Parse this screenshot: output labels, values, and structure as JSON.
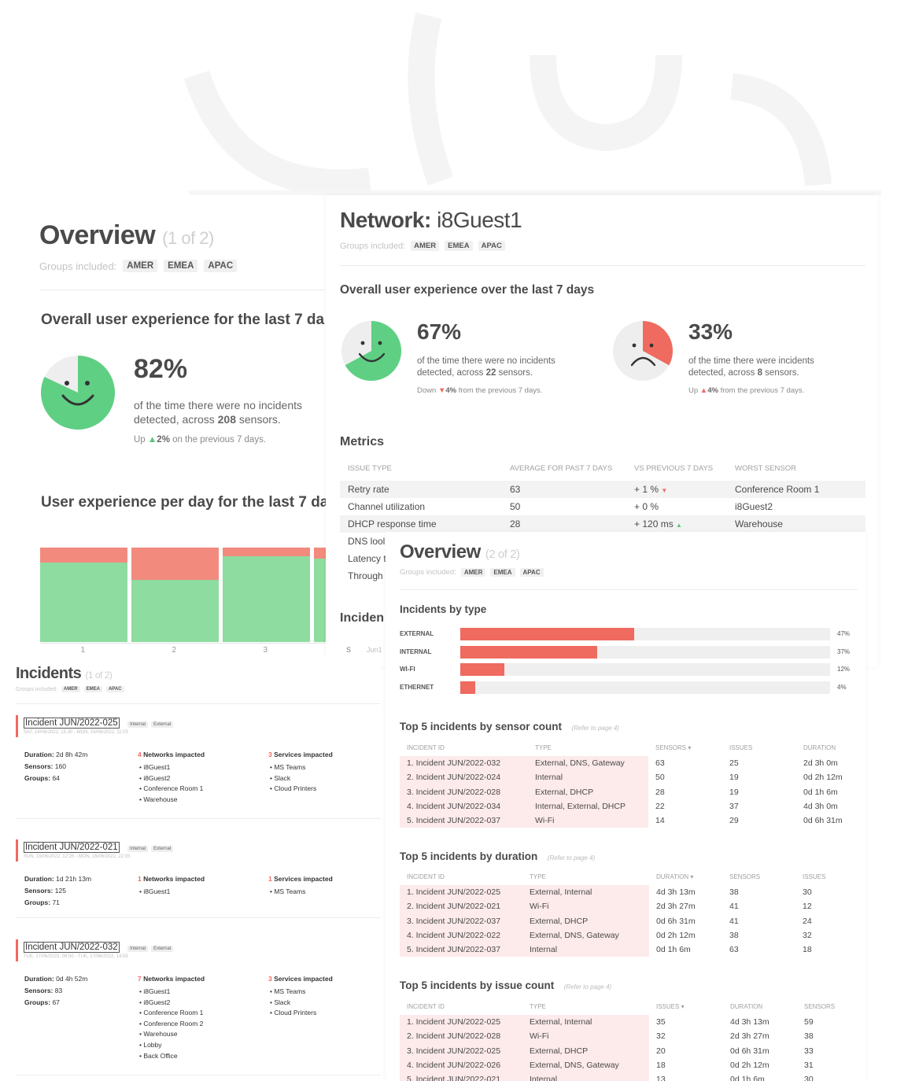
{
  "colors": {
    "green": "#8edc9f",
    "red": "#ef6a5f",
    "salmon": "#f38a7e",
    "chip": "#f0f0f0"
  },
  "overview1": {
    "title": "Overview",
    "sub": "(1 of 2)",
    "groups_label": "Groups included:",
    "groups": [
      "AMER",
      "EMEA",
      "APAC"
    ],
    "ux_heading": "Overall user experience for the last 7 da",
    "percent": "82%",
    "desc1": "of the time there were no incidents",
    "desc2_prefix": "detected, across ",
    "desc2_count": "208",
    "desc2_suffix": " sensors.",
    "trend_prefix": "Up ",
    "trend_value": "2%",
    "trend_suffix": " on the previous 7 days.",
    "pie_value": 0.82,
    "per_day_heading": "User experience per day for the last 7 da",
    "day_labels": [
      "1",
      "2",
      "3"
    ]
  },
  "chart_data": {
    "type": "bar",
    "categories": [
      "1",
      "2",
      "3"
    ],
    "series": [
      {
        "values": [
          0.84,
          0.66,
          0.91
        ]
      },
      {
        "values": [
          0.16,
          0.34,
          0.09
        ]
      }
    ],
    "ylim": [
      0,
      1
    ]
  },
  "network": {
    "title": "Network:",
    "name": "i8Guest1",
    "groups_label": "Groups included:",
    "groups": [
      "AMER",
      "EMEA",
      "APAC"
    ],
    "ux_heading": "Overall user experience over the last 7 days",
    "good": {
      "percent": "67%",
      "desc1": "of the time there were no incidents",
      "desc2_prefix": "detected, across ",
      "desc2_count": "22",
      "desc2_suffix": " sensors.",
      "trend_prefix": "Down ",
      "trend_value": "4%",
      "trend_suffix": " from the previous 7 days.",
      "pie_value": 0.67
    },
    "bad": {
      "percent": "33%",
      "desc1": "of the time there were incidents",
      "desc2_prefix": "detected, across ",
      "desc2_count": "8",
      "desc2_suffix": " sensors.",
      "trend_prefix": "Up ",
      "trend_value": "4%",
      "trend_suffix": " from the previous 7 days.",
      "pie_value": 0.33
    },
    "metrics_heading": "Metrics",
    "metrics_headers": [
      "Issue type",
      "Average for past 7 days",
      "VS previous 7 days",
      "Worst sensor"
    ],
    "metrics_rows": [
      [
        "Retry rate",
        "63",
        "+ 1 %",
        "Conference Room 1"
      ],
      [
        "Channel utilization",
        "50",
        "+ 0 %",
        "i8Guest2"
      ],
      [
        "DHCP response time",
        "28",
        "+ 120 ms",
        "Warehouse"
      ],
      [
        "DNS lool",
        "",
        "",
        ""
      ],
      [
        "Latency t",
        "",
        "",
        ""
      ],
      [
        "Through",
        "",
        "",
        ""
      ]
    ],
    "incidents_heading": "Inciden",
    "inc_row": [
      "S",
      "Jun1"
    ]
  },
  "overview2": {
    "title": "Overview",
    "sub": "(2 of 2)",
    "groups_label": "Groups included:",
    "groups": [
      "AMER",
      "EMEA",
      "APAC"
    ],
    "by_type_heading": "Incidents by type",
    "by_type": [
      {
        "label": "EXTERNAL",
        "value": 0.47,
        "pct": "47%"
      },
      {
        "label": "INTERNAL",
        "value": 0.37,
        "pct": "37%"
      },
      {
        "label": "WI-FI",
        "value": 0.12,
        "pct": "12%"
      },
      {
        "label": "ETHERNET",
        "value": 0.04,
        "pct": "4%"
      }
    ],
    "sensor_heading": "Top 5 incidents by sensor count",
    "sensor_ref": "(Refer to page 4)",
    "sensor_headers": [
      "Incident ID",
      "Type",
      "Sensors ▾",
      "Issues",
      "Duration"
    ],
    "sensor_rows": [
      [
        "1. Incident JUN/2022-032",
        "External, DNS, Gateway",
        "63",
        "25",
        "2d 3h 0m"
      ],
      [
        "2. Incident JUN/2022-024",
        "Internal",
        "50",
        "19",
        "0d 2h 12m"
      ],
      [
        "3. Incident JUN/2022-028",
        "External, DHCP",
        "28",
        "19",
        "0d 1h 6m"
      ],
      [
        "4. Incident JUN/2022-034",
        "Internal, External, DHCP",
        "22",
        "37",
        "4d 3h 0m"
      ],
      [
        "5. Incident JUN/2022-037",
        "Wi-Fi",
        "14",
        "29",
        "0d 6h 31m"
      ]
    ],
    "duration_heading": "Top 5 incidents by duration",
    "duration_ref": "(Refer to page 4)",
    "duration_headers": [
      "Incident ID",
      "Type",
      "Duration ▾",
      "Sensors",
      "Issues"
    ],
    "duration_rows": [
      [
        "1. Incident JUN/2022-025",
        "External, Internal",
        "4d 3h 13m",
        "38",
        "30"
      ],
      [
        "2. Incident JUN/2022-021",
        "Wi-Fi",
        "2d 3h 27m",
        "41",
        "12"
      ],
      [
        "3. Incident JUN/2022-037",
        "External, DHCP",
        "0d 6h 31m",
        "41",
        "24"
      ],
      [
        "4. Incident JUN/2022-022",
        "External, DNS, Gateway",
        "0d 2h 12m",
        "38",
        "32"
      ],
      [
        "5. Incident JUN/2022-037",
        "Internal",
        "0d 1h 6m",
        "63",
        "18"
      ]
    ],
    "issue_heading": "Top 5 incidents by issue count",
    "issue_ref": "(Refer to page 4)",
    "issue_headers": [
      "Incident ID",
      "Type",
      "Issues ▾",
      "Duration",
      "Sensors"
    ],
    "issue_rows": [
      [
        "1. Incident JUN/2022-025",
        "External, Internal",
        "35",
        "4d 3h 13m",
        "59"
      ],
      [
        "2. Incident JUN/2022-028",
        "Wi-Fi",
        "32",
        "2d 3h 27m",
        "38"
      ],
      [
        "3. Incident JUN/2022-025",
        "External, DHCP",
        "20",
        "0d 6h 31m",
        "33"
      ],
      [
        "4. Incident JUN/2022-026",
        "External, DNS, Gateway",
        "18",
        "0d 2h 12m",
        "31"
      ],
      [
        "5. Incident JUN/2022-021",
        "Internal",
        "13",
        "0d 1h 6m",
        "30"
      ]
    ]
  },
  "incidents": {
    "title": "Incidents",
    "sub": "(1 of 2)",
    "groups_label": "Groups included:",
    "groups": [
      "AMER",
      "EMEA",
      "APAC"
    ],
    "list": [
      {
        "id": "Incident JUN/2022-025",
        "tags": [
          "Internal",
          "External"
        ],
        "dates": "SAT, 14/06/2022, 15:30 - MON, 16/06/2022, 11:03",
        "duration_label": "Duration:",
        "duration": "2d 8h 42m",
        "sensors_label": "Sensors:",
        "sensors": "160",
        "groups_label": "Groups:",
        "groups": "64",
        "networks_count": "4",
        "networks_label": "Networks impacted",
        "networks": [
          "i8Guest1",
          "i8Guest2",
          "Conference Room 1",
          "Warehouse"
        ],
        "services_count": "3",
        "services_label": "Services impacted",
        "services": [
          "MS Teams",
          "Slack",
          "Cloud Printers"
        ]
      },
      {
        "id": "Incident JUN/2022-021",
        "tags": [
          "Internal",
          "External"
        ],
        "dates": "SUN, 15/06/2022, 12:25 - MON, 16/06/2022, 22:05",
        "duration_label": "Duration:",
        "duration": "1d 21h 13m",
        "sensors_label": "Sensors:",
        "sensors": "125",
        "groups_label": "Groups:",
        "groups": "71",
        "networks_count": "1",
        "networks_label": "Networks impacted",
        "networks": [
          "i8Guest1"
        ],
        "services_count": "1",
        "services_label": "Services impacted",
        "services": [
          "MS Teams"
        ]
      },
      {
        "id": "Incident JUN/2022-032",
        "tags": [
          "Internal",
          "External"
        ],
        "dates": "TUE, 17/06/2022, 09:50 - TUE, 17/06/2022, 14:03",
        "duration_label": "Duration:",
        "duration": "0d 4h 52m",
        "sensors_label": "Sensors:",
        "sensors": "83",
        "groups_label": "Groups:",
        "groups": "67",
        "networks_count": "7",
        "networks_label": "Networks impacted",
        "networks": [
          "i8Guest1",
          "i8Guest2",
          "Conference Room 1",
          "Conference Room 2",
          "Warehouse",
          "Lobby",
          "Back Office"
        ],
        "services_count": "3",
        "services_label": "Services impacted",
        "services": [
          "MS Teams",
          "Slack",
          "Cloud Printers"
        ]
      }
    ]
  }
}
